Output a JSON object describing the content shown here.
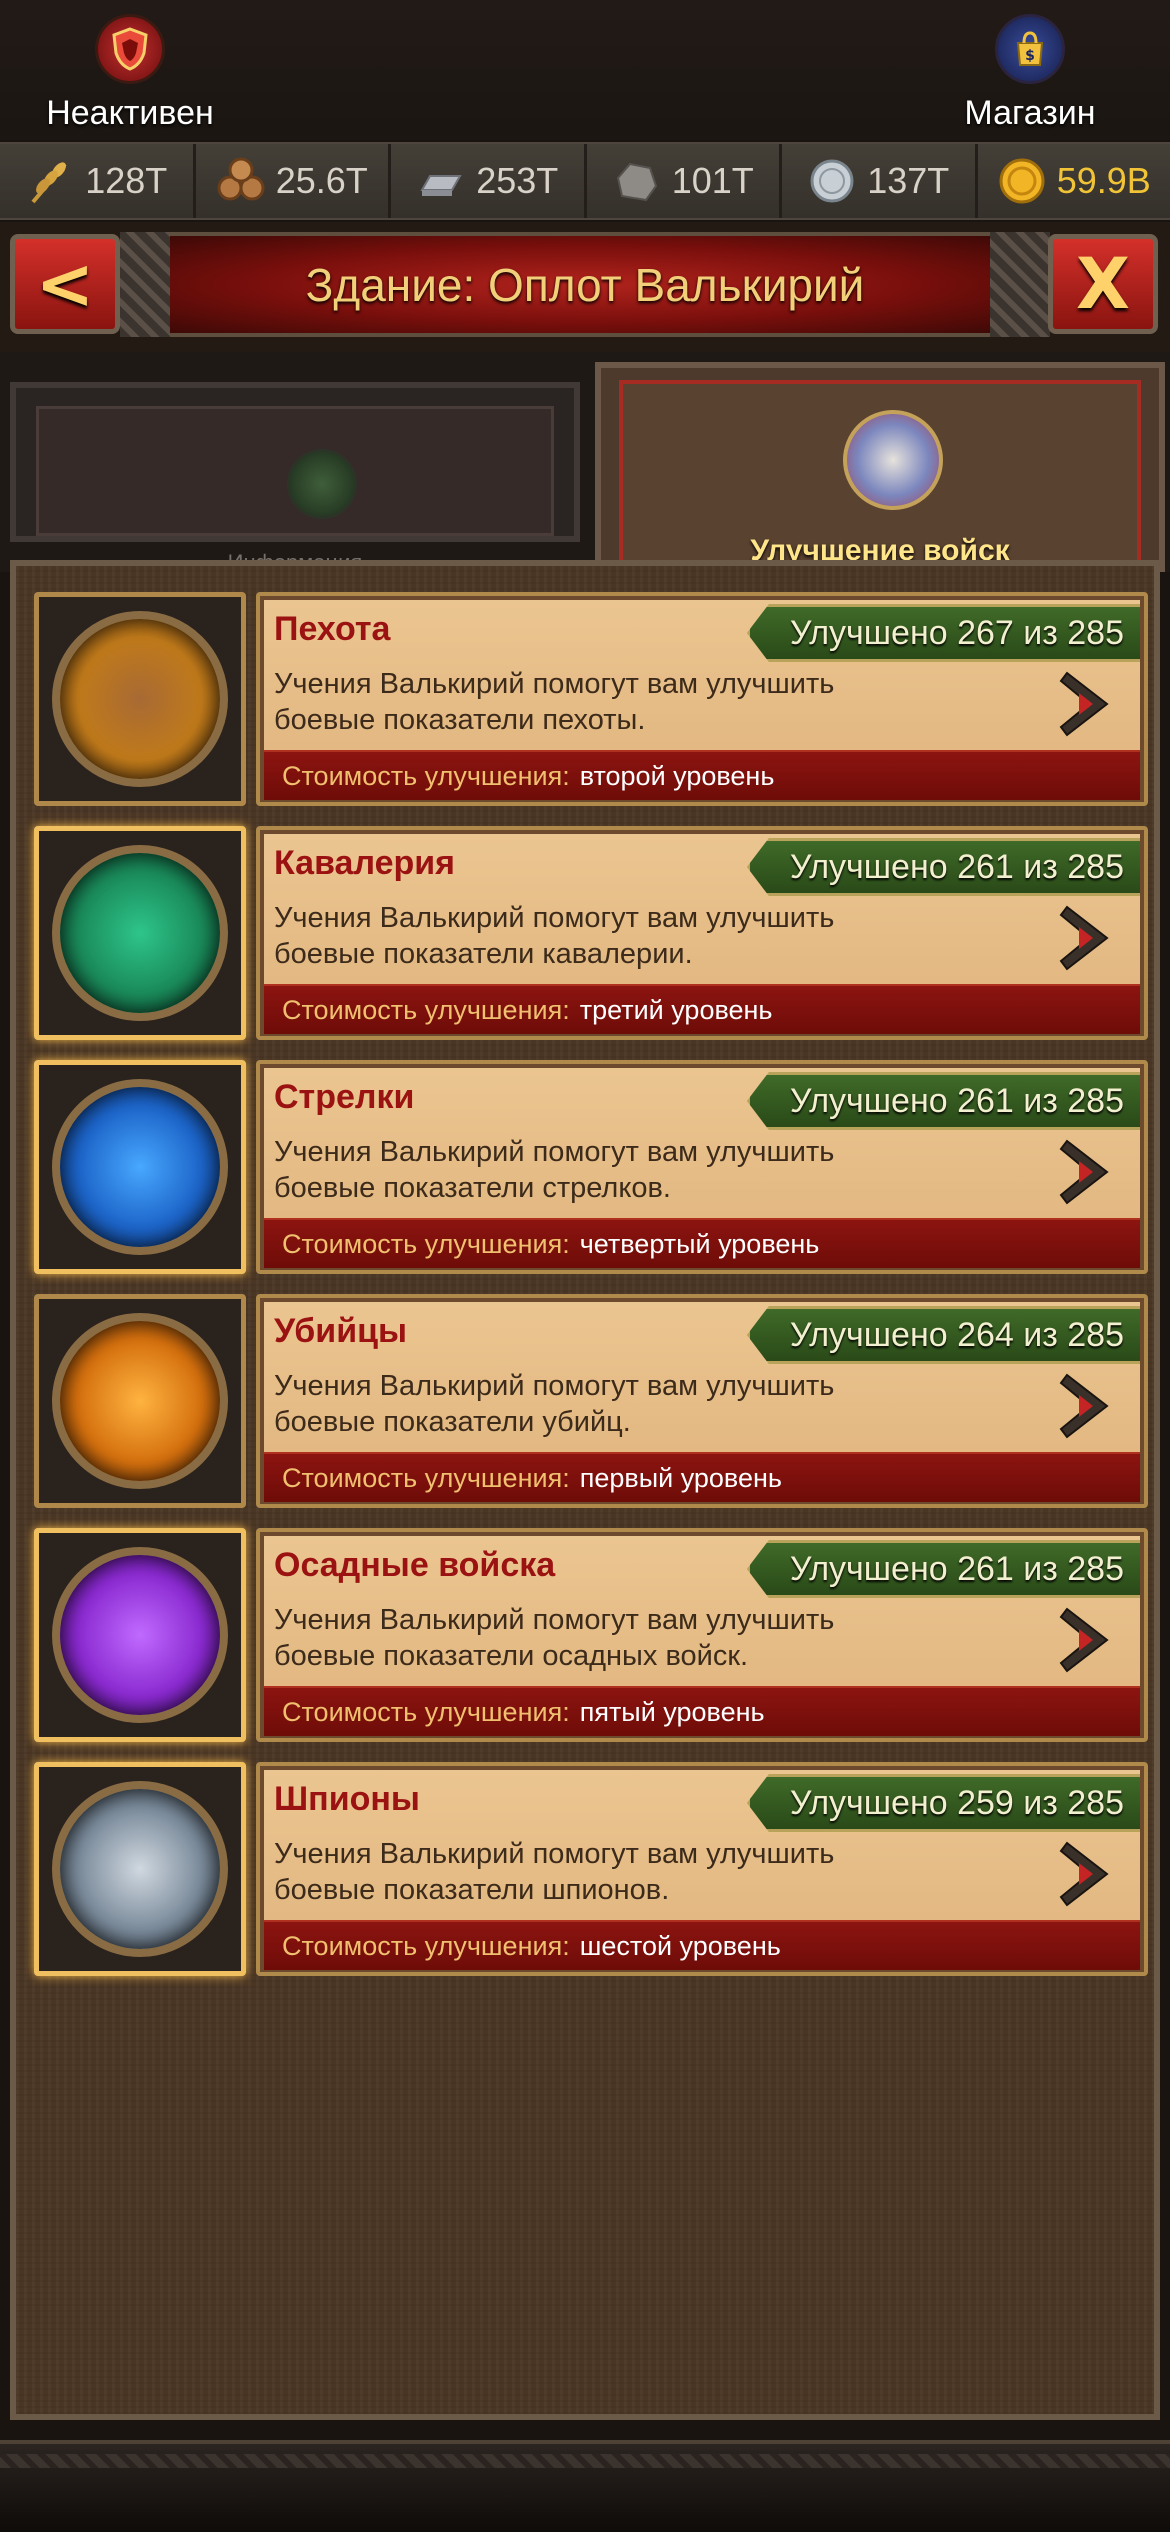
{
  "top": {
    "inactive_label": "Неактивен",
    "shop_label": "Магазин"
  },
  "resources": [
    {
      "name": "food",
      "value": "128T",
      "icon": "wheat-icon"
    },
    {
      "name": "wood",
      "value": "25.6T",
      "icon": "logs-icon"
    },
    {
      "name": "iron",
      "value": "253T",
      "icon": "iron-ingot-icon"
    },
    {
      "name": "stone",
      "value": "101T",
      "icon": "stone-icon"
    },
    {
      "name": "silver",
      "value": "137T",
      "icon": "silver-coin-icon"
    },
    {
      "name": "gold",
      "value": "59.9B",
      "icon": "gold-coin-icon"
    }
  ],
  "header": {
    "title": "Здание: Оплот Валькирий",
    "back_glyph": "<",
    "close_glyph": "X"
  },
  "tabs": [
    {
      "label": "Информация",
      "active": false
    },
    {
      "label": "Улучшение войск",
      "active": true
    }
  ],
  "units": [
    {
      "name": "Пехота",
      "progress": "Улучшено 267 из 285",
      "description": "Учения Валькирий помогут вам улучшить боевые показатели пехоты.",
      "cost_label": "Стоимость улучшения:",
      "cost_value": "второй уровень",
      "medal_color": "#c07a1a"
    },
    {
      "name": "Кавалерия",
      "progress": "Улучшено 261 из 285",
      "description": "Учения Валькирий помогут вам улучшить боевые показатели кавалерии.",
      "cost_label": "Стоимость улучшения:",
      "cost_value": "третий уровень",
      "medal_color": "#1a8a5a"
    },
    {
      "name": "Стрелки",
      "progress": "Улучшено 261 из 285",
      "description": "Учения Валькирий помогут вам улучшить боевые показатели стрелков.",
      "cost_label": "Стоимость улучшения:",
      "cost_value": "четвертый уровень",
      "medal_color": "#1c64c8"
    },
    {
      "name": "Убийцы",
      "progress": "Улучшено 264 из 285",
      "description": "Учения Валькирий помогут вам улучшить боевые показатели убийц.",
      "cost_label": "Стоимость улучшения:",
      "cost_value": "первый уровень",
      "medal_color": "#d4700e"
    },
    {
      "name": "Осадные войска",
      "progress": "Улучшено 261 из 285",
      "description": "Учения Валькирий помогут вам улучшить боевые показатели осадных войск.",
      "cost_label": "Стоимость улучшения:",
      "cost_value": "пятый уровень",
      "medal_color": "#8a2ad0"
    },
    {
      "name": "Шпионы",
      "progress": "Улучшено 259 из 285",
      "description": "Учения Валькирий помогут вам улучшить боевые показатели шпионов.",
      "cost_label": "Стоимость улучшения:",
      "cost_value": "шестой уровень",
      "medal_color": "#7a8a9a"
    }
  ]
}
